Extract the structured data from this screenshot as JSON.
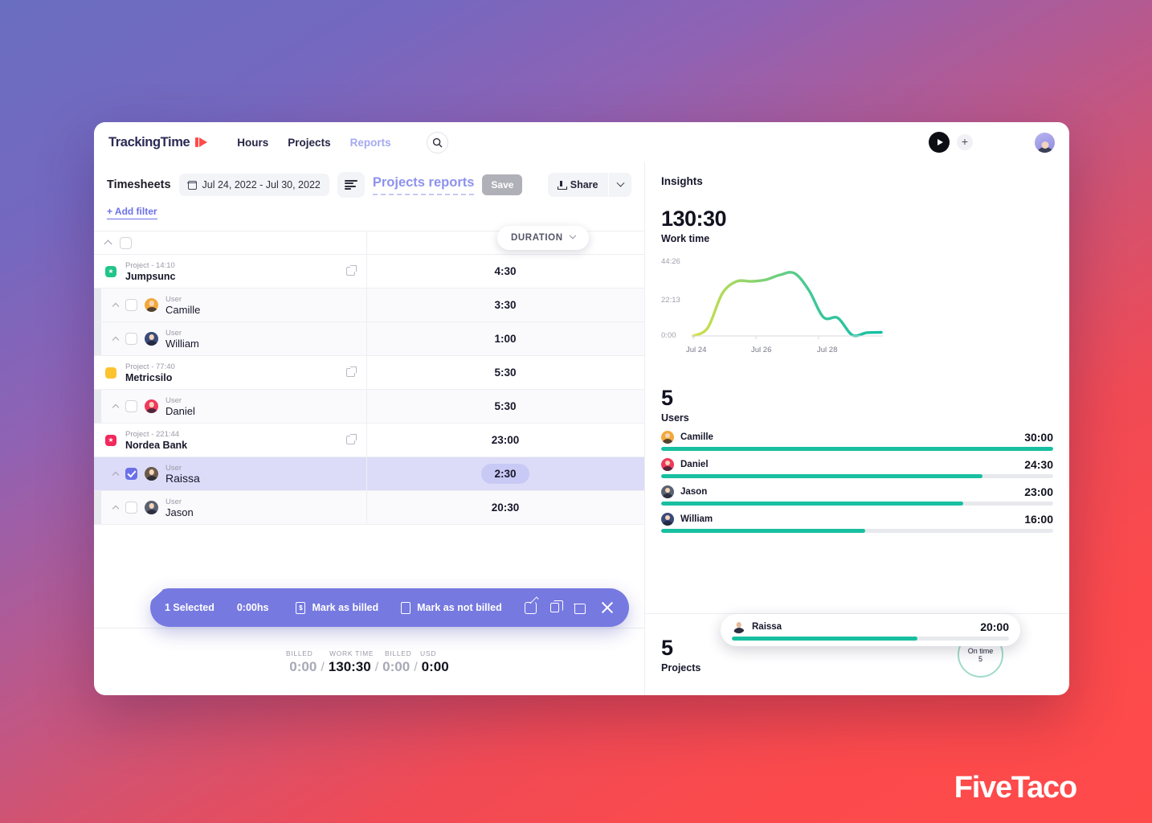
{
  "app": {
    "brand": "TrackingTime",
    "nav": [
      {
        "label": "Hours",
        "muted": false
      },
      {
        "label": "Projects",
        "muted": false
      },
      {
        "label": "Reports",
        "muted": true
      }
    ],
    "search_icon": "search-icon",
    "play_icon": "play-icon",
    "add_icon": "plus-icon",
    "avatar": "user-avatar"
  },
  "toolbar": {
    "title": "Timesheets",
    "date_range": "Jul 24, 2022 - Jul 30, 2022",
    "report_name": "Projects reports",
    "save_label": "Save",
    "share_label": "Share",
    "add_filter_label": "+ Add filter"
  },
  "table": {
    "column_header": "DURATION",
    "rows": [
      {
        "kind": "project",
        "sub": "Project - 14:10",
        "name": "Jumpsunc",
        "duration": "4:30",
        "color": "#22c48a",
        "selected": false
      },
      {
        "kind": "user",
        "sub": "User",
        "name": "Camille",
        "duration": "3:30",
        "color": "#f2a93b",
        "selected": false
      },
      {
        "kind": "user",
        "sub": "User",
        "name": "William",
        "duration": "1:00",
        "color": "#3a4a7a",
        "selected": false
      },
      {
        "kind": "project",
        "sub": "Project - 77:40",
        "name": "Metricsilo",
        "duration": "5:30",
        "color": "#fcc330",
        "selected": false
      },
      {
        "kind": "user",
        "sub": "User",
        "name": "Daniel",
        "duration": "5:30",
        "color": "#f1395c",
        "selected": false
      },
      {
        "kind": "project",
        "sub": "Project - 221:44",
        "name": "Nordea Bank",
        "duration": "23:00",
        "color": "#f1295c",
        "selected": false
      },
      {
        "kind": "user",
        "sub": "User",
        "name": "Raissa",
        "duration": "2:30",
        "color": "#6b5a4a",
        "selected": true
      },
      {
        "kind": "user",
        "sub": "User",
        "name": "Jason",
        "duration": "20:30",
        "color": "#5a6170",
        "selected": false
      }
    ]
  },
  "action_bar": {
    "selected_label": "1 Selected",
    "hours_label": "0:00hs",
    "mark_billed_label": "Mark as billed",
    "mark_not_billed_label": "Mark as not billed",
    "edit_icon": "edit-icon",
    "duplicate_icon": "copy-icon",
    "delete_icon": "trash-icon",
    "close_icon": "close-icon"
  },
  "footer": {
    "labels": [
      "BILLED",
      "WORK TIME",
      "BILLED",
      "USD"
    ],
    "values": [
      "0:00",
      "130:30",
      "0:00",
      "0:00"
    ],
    "separator": "/"
  },
  "insights": {
    "title": "Insights",
    "work_time_value": "130:30",
    "work_time_label": "Work time",
    "users_count": "5",
    "users_label": "Users",
    "projects_count": "5",
    "projects_label": "Projects",
    "donut_label": "On time",
    "donut_value": "5",
    "accent_color": "#18bfa0",
    "users": [
      {
        "name": "Camille",
        "value": "30:00",
        "pct": 100,
        "color": "#f2a93b"
      },
      {
        "name": "Daniel",
        "value": "24:30",
        "pct": 82,
        "color": "#f1395c"
      },
      {
        "name": "Jason",
        "value": "23:00",
        "pct": 77,
        "color": "#5a6170"
      },
      {
        "name": "William",
        "value": "16:00",
        "pct": 52,
        "color": "#3a4a7a"
      }
    ],
    "hover_user": {
      "name": "Raissa",
      "value": "20:00",
      "pct": 67
    }
  },
  "chart_data": {
    "type": "line",
    "title": "Work time",
    "xlabel": "",
    "ylabel": "",
    "ylim": [
      0,
      44.43
    ],
    "ytick_labels": [
      "0:00",
      "22:13",
      "44:26"
    ],
    "xtick_labels": [
      "Jul 24",
      "Jul 26",
      "Jul 28"
    ],
    "x": [
      "Jul 24",
      "Jul 24.5",
      "Jul 25",
      "Jul 25.5",
      "Jul 26",
      "Jul 26.5",
      "Jul 27",
      "Jul 27.5",
      "Jul 28",
      "Jul 28.5",
      "Jul 29",
      "Jul 29.5",
      "Jul 30"
    ],
    "values": [
      0.0,
      5.0,
      26.0,
      33.5,
      33.5,
      34.5,
      37.5,
      38.5,
      28.0,
      11.5,
      11.0,
      0.5,
      2.0,
      2.2
    ],
    "line_gradient": [
      "#d4e04a",
      "#8ed46b",
      "#3fc79a",
      "#11bfa4"
    ],
    "grid": false,
    "legend": "none"
  },
  "watermark": "FiveTaco"
}
